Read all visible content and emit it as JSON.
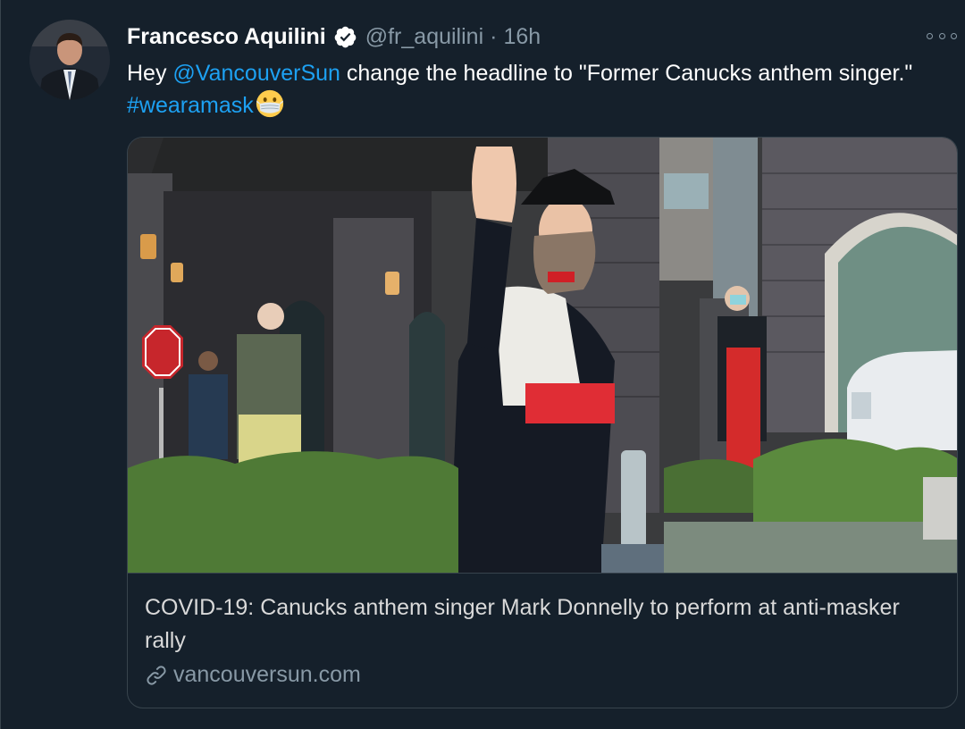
{
  "tweet": {
    "display_name": "Francesco Aquilini",
    "handle": "@fr_aquilini",
    "separator": "·",
    "timestamp": "16h",
    "text_before_mention": "Hey ",
    "mention": "@VancouverSun",
    "text_after_mention": " change the headline to \"Former Canucks anthem singer.\" ",
    "hashtag": "#wearamask",
    "emoji": "face-with-medical-mask"
  },
  "card": {
    "title": "COVID-19: Canucks anthem singer Mark Donnelly to perform at anti-masker rally",
    "domain": "vancouversun.com"
  },
  "icons": {
    "verified": "verified-badge-icon",
    "more": "more-options-icon",
    "link": "link-icon"
  },
  "colors": {
    "background": "#15202b",
    "accent": "#1da1f2",
    "secondary_text": "#8899a6",
    "border": "#38444d"
  }
}
